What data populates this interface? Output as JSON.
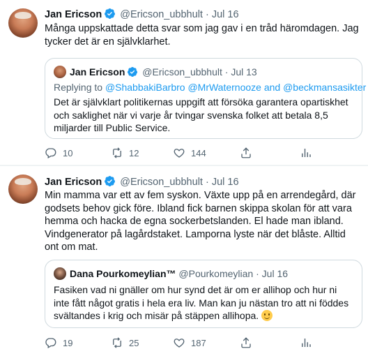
{
  "tweets": [
    {
      "author": "Jan Ericson",
      "handle": "@Ericson_ubbhult",
      "dot": "·",
      "date": "Jul 16",
      "text": "Många uppskattade detta svar som jag gav i en tråd häromdagen. Jag tycker det är en självklarhet.",
      "quote": {
        "author": "Jan Ericson",
        "handle": "@Ericson_ubbhult",
        "dot": "·",
        "date": "Jul 13",
        "replying_prefix": "Replying to",
        "replying_to": "@ShabbakiBarbro @MrWaternooze and @beckmansasikter",
        "text": "Det är självklart politikernas uppgift att försöka garantera opartiskhet och saklighet när vi varje år tvingar svenska folket att betala 8,5 miljarder till Public Service."
      },
      "replies": "10",
      "retweets": "12",
      "likes": "144"
    },
    {
      "author": "Jan Ericson",
      "handle": "@Ericson_ubbhult",
      "dot": "·",
      "date": "Jul 16",
      "text": "Min mamma var ett av fem syskon. Växte upp på en arrendegård, där godsets behov gick före. Ibland fick barnen skippa skolan för att vara hemma och hacka de egna sockerbetslanden. El hade man ibland. Vindgenerator på lagårdstaket. Lamporna lyste när det blåste. Alltid ont om mat.",
      "quote": {
        "author": "Dana Pourkomeylian™",
        "handle": "@Pourkomeylian",
        "dot": "·",
        "date": "Jul 16",
        "text": "Fasiken vad ni gnäller om hur synd det är om er allihop och hur ni inte fått något gratis i hela era liv. Man kan ju nästan tro att ni föddes svältandes i krig och misär på stäppen allihopa."
      },
      "replies": "19",
      "retweets": "25",
      "likes": "187"
    }
  ],
  "icons": {
    "verified": "verified-badge-icon",
    "reply": "reply-icon",
    "retweet": "retweet-icon",
    "like": "heart-icon",
    "analytics": "analytics-icon",
    "emoji": "smiling-face-emoji"
  },
  "colors": {
    "accent": "#1d9bf0",
    "muted": "#536471",
    "text": "#0f1419",
    "border": "#cfd9de"
  }
}
